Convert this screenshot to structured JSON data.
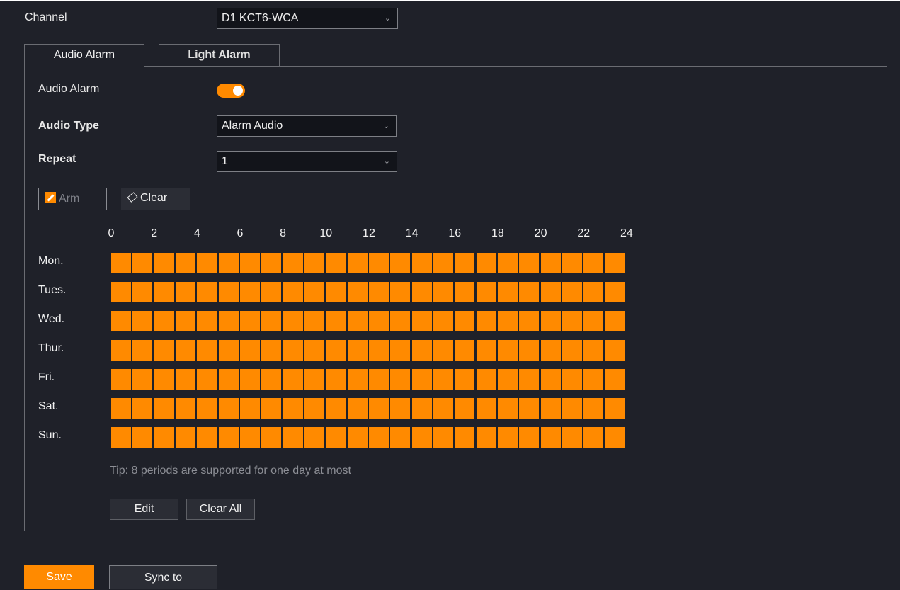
{
  "channel": {
    "label": "Channel",
    "value": "D1 KCT6-WCA"
  },
  "tabs": [
    {
      "label": "Audio Alarm"
    },
    {
      "label": "Light Alarm"
    }
  ],
  "audio_alarm": {
    "label": "Audio Alarm",
    "enabled": true
  },
  "audio_type": {
    "label": "Audio Type",
    "value": "Alarm Audio"
  },
  "repeat": {
    "label": "Repeat",
    "value": "1"
  },
  "tools": {
    "arm_label": "Arm",
    "clear_label": "Clear"
  },
  "schedule": {
    "hours": [
      "0",
      "2",
      "4",
      "6",
      "8",
      "10",
      "12",
      "14",
      "16",
      "18",
      "20",
      "22",
      "24"
    ],
    "days": [
      "Mon.",
      "Tues.",
      "Wed.",
      "Thur.",
      "Fri.",
      "Sat.",
      "Sun."
    ],
    "cells_per_day": 24,
    "armed": "all"
  },
  "tip": "Tip: 8 periods are supported for one day at most",
  "buttons": {
    "edit": "Edit",
    "clear_all": "Clear All",
    "save": "Save",
    "sync": "Sync to"
  },
  "colors": {
    "accent": "#ff8a00",
    "background": "#1f2129"
  }
}
